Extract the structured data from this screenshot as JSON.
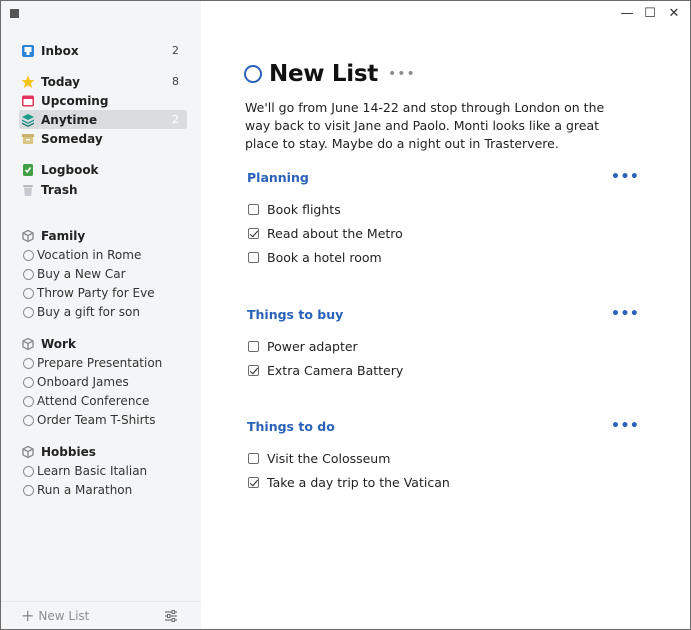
{
  "sidebar": {
    "inbox": {
      "label": "Inbox",
      "count": "2"
    },
    "today": {
      "label": "Today",
      "count": "8"
    },
    "upcoming": {
      "label": "Upcoming"
    },
    "anytime": {
      "label": "Anytime",
      "count": "2"
    },
    "someday": {
      "label": "Someday"
    },
    "logbook": {
      "label": "Logbook"
    },
    "trash": {
      "label": "Trash"
    },
    "areas": [
      {
        "name": "Family",
        "projects": [
          "Vocation in Rome",
          "Buy a New Car",
          "Throw Party for Eve",
          "Buy a gift for son"
        ]
      },
      {
        "name": "Work",
        "projects": [
          "Prepare Presentation",
          "Onboard James",
          "Attend Conference",
          "Order Team T-Shirts"
        ]
      },
      {
        "name": "Hobbies",
        "projects": [
          "Learn Basic Italian",
          "Run a Marathon"
        ]
      }
    ],
    "footer": {
      "new_list": "New List"
    }
  },
  "window": {
    "minimize": "—",
    "maximize": "☐",
    "close": "✕"
  },
  "main": {
    "title": "New List",
    "more": "•••",
    "notes": "We'll go from June 14-22 and stop through London on the way back to visit Jane and Paolo. Monti looks like a great place to stay. Maybe do a night out in Trastervere.",
    "headings": [
      {
        "title": "Planning",
        "todos": [
          {
            "text": "Book flights",
            "done": false
          },
          {
            "text": "Read about the Metro",
            "done": true
          },
          {
            "text": "Book a hotel room",
            "done": false
          }
        ]
      },
      {
        "title": "Things to buy",
        "todos": [
          {
            "text": "Power adapter",
            "done": false
          },
          {
            "text": "Extra Camera Battery",
            "done": true
          }
        ]
      },
      {
        "title": "Things to do",
        "todos": [
          {
            "text": "Visit the Colosseum",
            "done": false
          },
          {
            "text": "Take a day trip to the Vatican",
            "done": true
          }
        ]
      }
    ]
  },
  "colors": {
    "accent": "#2a63b8",
    "sidebar_bg": "#f4f5f6",
    "today_star": "#f5c518",
    "upcoming": "#e2365f",
    "anytime": "#1a9b8c",
    "someday": "#c9b36c",
    "logbook": "#43a047",
    "inbox": "#2a85d6"
  }
}
